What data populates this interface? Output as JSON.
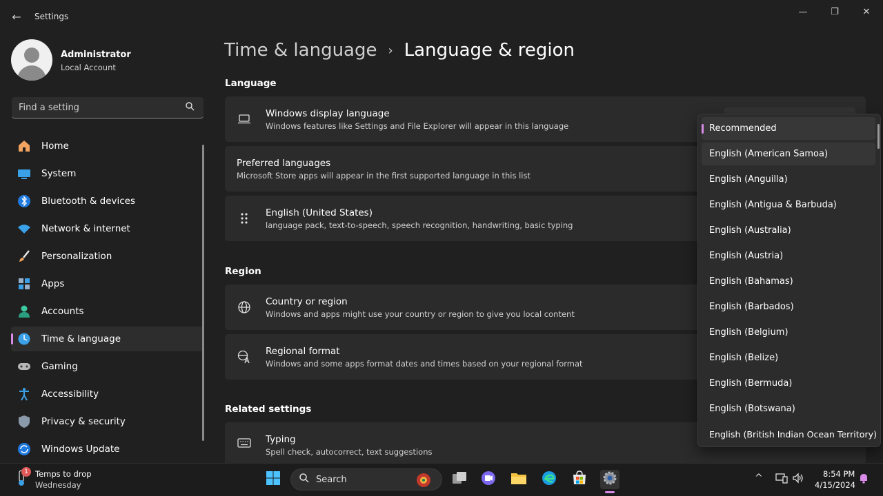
{
  "window": {
    "title": "Settings",
    "back_glyph": "←",
    "minimize_glyph": "—",
    "maximize_glyph": "❐",
    "close_glyph": "✕"
  },
  "user": {
    "name": "Administrator",
    "account_type": "Local Account"
  },
  "search": {
    "placeholder": "Find a setting"
  },
  "nav": {
    "items": [
      {
        "label": "Home",
        "icon": "home-icon"
      },
      {
        "label": "System",
        "icon": "system-icon"
      },
      {
        "label": "Bluetooth & devices",
        "icon": "bluetooth-icon"
      },
      {
        "label": "Network & internet",
        "icon": "network-icon"
      },
      {
        "label": "Personalization",
        "icon": "brush-icon"
      },
      {
        "label": "Apps",
        "icon": "apps-icon"
      },
      {
        "label": "Accounts",
        "icon": "accounts-icon"
      },
      {
        "label": "Time & language",
        "icon": "time-language-icon",
        "active": true
      },
      {
        "label": "Gaming",
        "icon": "gaming-icon"
      },
      {
        "label": "Accessibility",
        "icon": "accessibility-icon"
      },
      {
        "label": "Privacy & security",
        "icon": "shield-icon"
      },
      {
        "label": "Windows Update",
        "icon": "update-icon"
      }
    ]
  },
  "breadcrumb": {
    "parent": "Time & language",
    "separator": "›",
    "current": "Language & region"
  },
  "sections": {
    "language": "Language",
    "region": "Region",
    "related": "Related settings"
  },
  "cards": {
    "display_language": {
      "title": "Windows display language",
      "subtitle": "Windows features like Settings and File Explorer will appear in this language"
    },
    "preferred_languages": {
      "title": "Preferred languages",
      "subtitle": "Microsoft Store apps will appear in the first supported language in this list"
    },
    "english_us": {
      "title": "English (United States)",
      "subtitle": "language pack, text-to-speech, speech recognition, handwriting, basic typing"
    },
    "country_region": {
      "title": "Country or region",
      "subtitle": "Windows and apps might use your country or region to give you local content"
    },
    "regional_format": {
      "title": "Regional format",
      "subtitle": "Windows and some apps format dates and times based on your regional format"
    },
    "typing": {
      "title": "Typing",
      "subtitle": "Spell check, autocorrect, text suggestions"
    }
  },
  "dropdown": {
    "options": [
      "Recommended",
      "English (American Samoa)",
      "English (Anguilla)",
      "English (Antigua & Barbuda)",
      "English (Australia)",
      "English (Austria)",
      "English (Bahamas)",
      "English (Barbados)",
      "English (Belgium)",
      "English (Belize)",
      "English (Bermuda)",
      "English (Botswana)",
      "English (British Indian Ocean Territory)"
    ],
    "selected_index": 0,
    "hover_index": 1
  },
  "taskbar": {
    "weather_badge": "1",
    "weather_title": "Temps to drop",
    "weather_sub": "Wednesday",
    "search_label": "Search",
    "time": "8:54 PM",
    "date": "4/15/2024",
    "chevron_glyph": "^"
  },
  "colors": {
    "accent": "#d88ce8",
    "background": "#202020",
    "card": "#2b2b2b"
  }
}
